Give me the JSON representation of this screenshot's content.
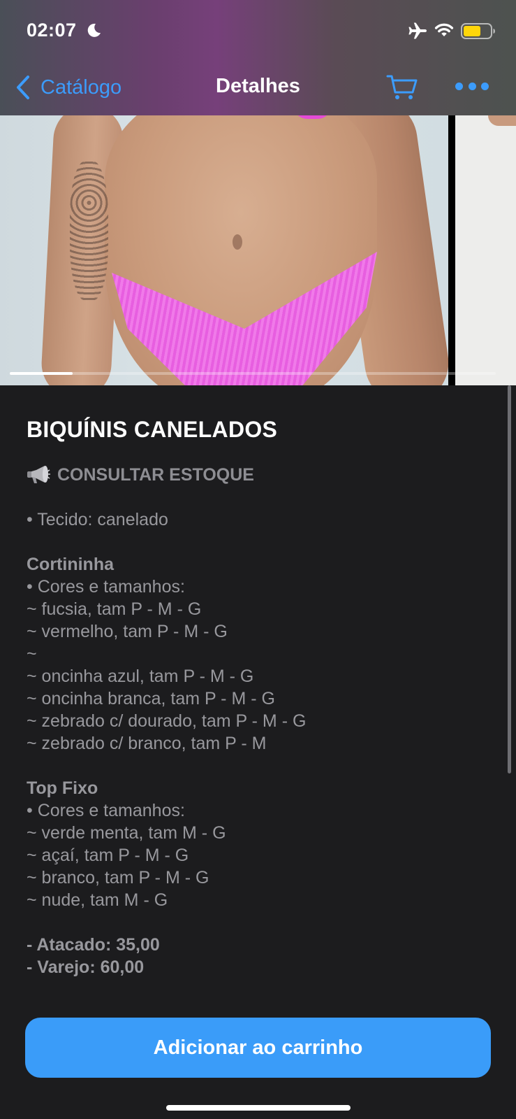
{
  "status_bar": {
    "time": "02:07",
    "battery_color": "#ffd60a"
  },
  "nav": {
    "back_label": "Catálogo",
    "title": "Detalhes",
    "accent_color": "#3c9cfb",
    "icons": [
      "chevron-left-icon",
      "cart-icon",
      "more-icon"
    ]
  },
  "gallery": {
    "progress_fraction": 0.13
  },
  "product": {
    "title": "BIQUÍNIS CANELADOS",
    "stock_label": "CONSULTAR ESTOQUE",
    "stock_icon": "megaphone-icon",
    "description": [
      {
        "text": "• Tecido: canelado",
        "bold": false
      },
      {
        "text": "",
        "bold": false
      },
      {
        "text": "Cortininha",
        "bold": true
      },
      {
        "text": "• Cores e tamanhos:",
        "bold": false
      },
      {
        "text": "~ fucsia, tam P - M - G",
        "bold": false
      },
      {
        "text": "~ vermelho, tam P - M - G",
        "bold": false
      },
      {
        "text": "~",
        "bold": false
      },
      {
        "text": "~ oncinha azul, tam P - M - G",
        "bold": false
      },
      {
        "text": "~ oncinha branca, tam P - M - G",
        "bold": false
      },
      {
        "text": "~ zebrado c/ dourado, tam P - M - G",
        "bold": false
      },
      {
        "text": "~ zebrado c/ branco, tam P - M",
        "bold": false
      },
      {
        "text": "",
        "bold": false
      },
      {
        "text": "Top Fixo",
        "bold": true
      },
      {
        "text": "• Cores e tamanhos:",
        "bold": false
      },
      {
        "text": "~ verde menta, tam M - G",
        "bold": false
      },
      {
        "text": "~ açaí, tam P - M - G",
        "bold": false
      },
      {
        "text": "~ branco, tam P - M - G",
        "bold": false
      },
      {
        "text": "~ nude, tam M - G",
        "bold": false
      },
      {
        "text": "",
        "bold": false
      },
      {
        "text": "- Atacado: 35,00",
        "bold": true
      },
      {
        "text": "- Varejo: 60,00",
        "bold": true
      }
    ]
  },
  "cta": {
    "label": "Adicionar ao carrinho",
    "color": "#3a9cf9"
  }
}
